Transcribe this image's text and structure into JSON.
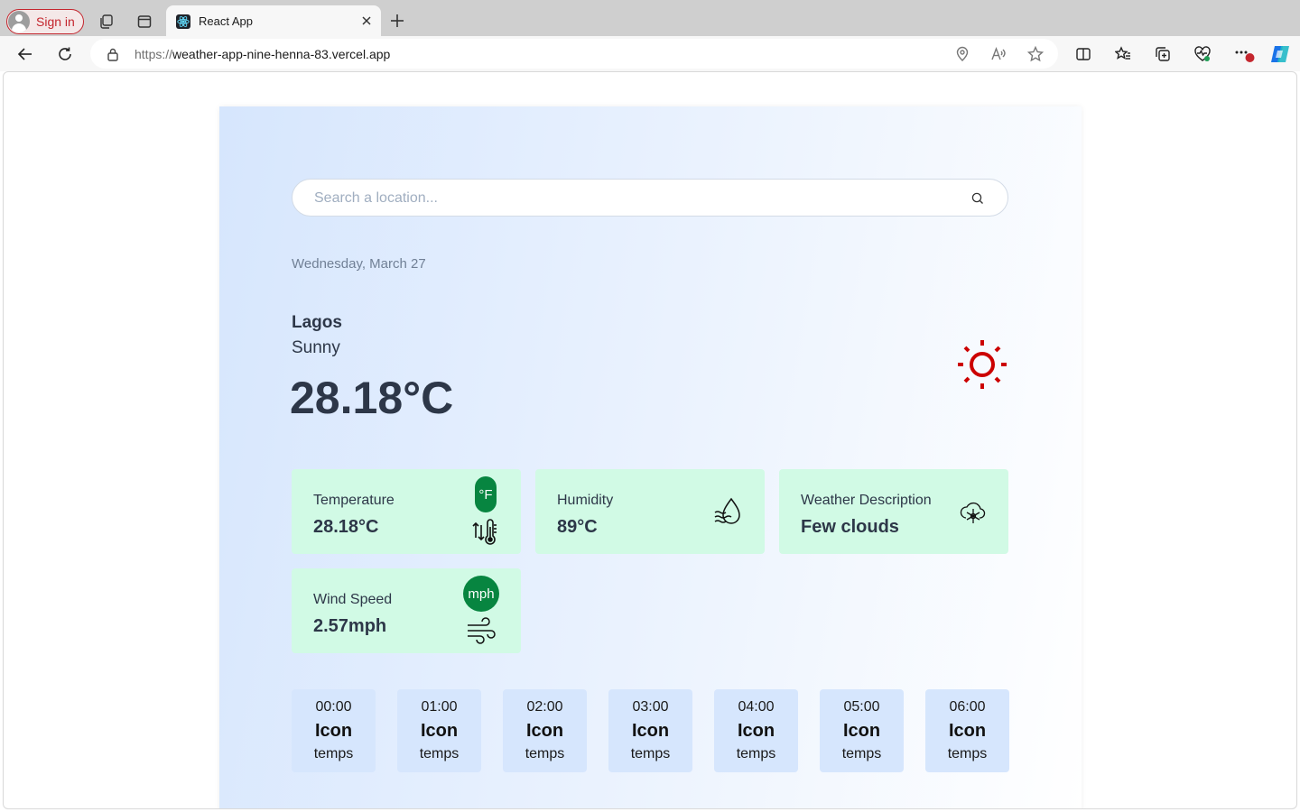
{
  "browser": {
    "sign_in_label": "Sign in",
    "tab_title": "React App",
    "url_protocol": "https://",
    "url_host": "weather-app-nine-henna-83.vercel.app",
    "notification_count": "1"
  },
  "search": {
    "placeholder": "Search a location..."
  },
  "current": {
    "date": "Wednesday, March 27",
    "city": "Lagos",
    "condition": "Sunny",
    "temperature": "28.18°C",
    "weather_icon": "sun-icon",
    "weather_icon_color": "#cc0000"
  },
  "cards": {
    "temperature": {
      "label": "Temperature",
      "value": "28.18°C",
      "unit_toggle": "°F",
      "icon": "thermometer-icon"
    },
    "humidity": {
      "label": "Humidity",
      "value": "89°C",
      "icon": "humidity-drop-icon"
    },
    "description": {
      "label": "Weather Description",
      "value": "Few clouds",
      "icon": "snowflake-cloud-icon"
    },
    "wind": {
      "label": "Wind Speed",
      "value": "2.57mph",
      "unit_toggle": "mph",
      "icon": "wind-icon"
    }
  },
  "hourly": [
    {
      "time": "00:00",
      "icon": "Icon",
      "temp": "temps"
    },
    {
      "time": "01:00",
      "icon": "Icon",
      "temp": "temps"
    },
    {
      "time": "02:00",
      "icon": "Icon",
      "temp": "temps"
    },
    {
      "time": "03:00",
      "icon": "Icon",
      "temp": "temps"
    },
    {
      "time": "04:00",
      "icon": "Icon",
      "temp": "temps"
    },
    {
      "time": "05:00",
      "icon": "Icon",
      "temp": "temps"
    },
    {
      "time": "06:00",
      "icon": "Icon",
      "temp": "temps"
    }
  ],
  "colors": {
    "card_background": "#d1fae5",
    "toggle_background": "#078540",
    "hour_background": "#d6e6fd",
    "text_primary": "#2d3748"
  }
}
